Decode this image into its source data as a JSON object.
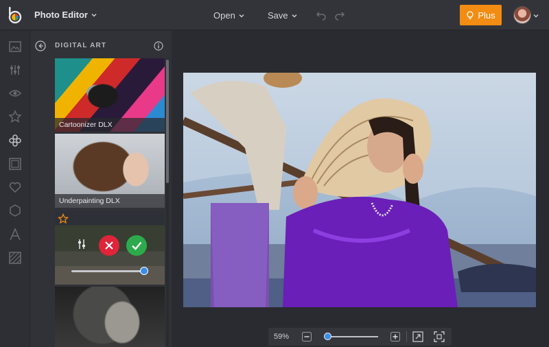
{
  "header": {
    "app_title": "Photo Editor",
    "menu": [
      {
        "label": "Open"
      },
      {
        "label": "Save"
      }
    ],
    "plus_label": "Plus"
  },
  "panel": {
    "title": "DIGITAL ART",
    "effects": [
      {
        "label": "Cartoonizer DLX"
      },
      {
        "label": "Underpainting DLX"
      }
    ],
    "active_effect_strength": 0.98
  },
  "zoom": {
    "percent_label": "59%",
    "level": 0.03
  },
  "icons": {
    "rail": [
      "image-icon",
      "adjust-icon",
      "eye-icon",
      "star-icon",
      "effects-icon",
      "frame-icon",
      "heart-icon",
      "hexagon-icon",
      "text-icon",
      "texture-icon"
    ]
  },
  "colors": {
    "accent": "#f28c12",
    "slider": "#3b8ee8",
    "cancel": "#e0243a",
    "apply": "#2daa4c"
  }
}
